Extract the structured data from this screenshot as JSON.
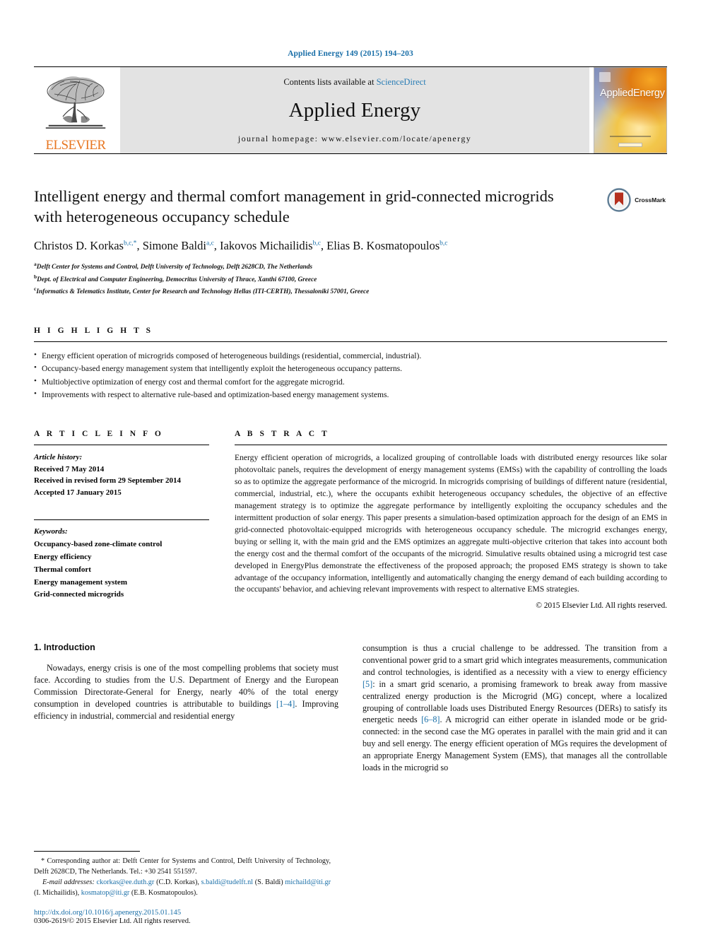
{
  "running_head": "Applied Energy 149 (2015) 194–203",
  "masthead": {
    "publisher": "ELSEVIER",
    "contents_prefix": "Contents lists available at ",
    "contents_link": "ScienceDirect",
    "journal_name": "Applied Energy",
    "homepage": "journal homepage: www.elsevier.com/locate/apenergy",
    "cover_title_a": "Applied",
    "cover_title_b": "Energy"
  },
  "article": {
    "title": "Intelligent energy and thermal comfort management in grid-connected microgrids with heterogeneous occupancy schedule",
    "crossmark_label": "CrossMark",
    "authors": [
      {
        "name": "Christos D. Korkas",
        "sup": "b,c,*"
      },
      {
        "name": "Simone Baldi",
        "sup": "a,c"
      },
      {
        "name": "Iakovos Michailidis",
        "sup": "b,c"
      },
      {
        "name": "Elias B. Kosmatopoulos",
        "sup": "b,c"
      }
    ],
    "affiliations": [
      {
        "mark": "a",
        "text": "Delft Center for Systems and Control, Delft University of Technology, Delft 2628CD, The Netherlands"
      },
      {
        "mark": "b",
        "text": "Dept. of Electrical and Computer Engineering, Democritus University of Thrace, Xanthi 67100, Greece"
      },
      {
        "mark": "c",
        "text": "Informatics & Telematics Institute, Center for Research and Technology Hellas (ITI-CERTH), Thessaloniki 57001, Greece"
      }
    ]
  },
  "highlights": {
    "heading": "H I G H L I G H T S",
    "items": [
      "Energy efficient operation of microgrids composed of heterogeneous buildings (residential, commercial, industrial).",
      "Occupancy-based energy management system that intelligently exploit the heterogeneous occupancy patterns.",
      "Multiobjective optimization of energy cost and thermal comfort for the aggregate microgrid.",
      "Improvements with respect to alternative rule-based and optimization-based energy management systems."
    ]
  },
  "article_info": {
    "heading": "A R T I C L E   I N F O",
    "history_label": "Article history:",
    "history": [
      "Received 7 May 2014",
      "Received in revised form 29 September 2014",
      "Accepted 17 January 2015"
    ],
    "keywords_label": "Keywords:",
    "keywords": [
      "Occupancy-based zone-climate control",
      "Energy efficiency",
      "Thermal comfort",
      "Energy management system",
      "Grid-connected microgrids"
    ]
  },
  "abstract": {
    "heading": "A B S T R A C T",
    "text": "Energy efficient operation of microgrids, a localized grouping of controllable loads with distributed energy resources like solar photovoltaic panels, requires the development of energy management systems (EMSs) with the capability of controlling the loads so as to optimize the aggregate performance of the microgrid. In microgrids comprising of buildings of different nature (residential, commercial, industrial, etc.), where the occupants exhibit heterogeneous occupancy schedules, the objective of an effective management strategy is to optimize the aggregate performance by intelligently exploiting the occupancy schedules and the intermittent production of solar energy. This paper presents a simulation-based optimization approach for the design of an EMS in grid-connected photovoltaic-equipped microgrids with heterogeneous occupancy schedule. The microgrid exchanges energy, buying or selling it, with the main grid and the EMS optimizes an aggregate multi-objective criterion that takes into account both the energy cost and the thermal comfort of the occupants of the microgrid. Simulative results obtained using a microgrid test case developed in EnergyPlus demonstrate the effectiveness of the proposed approach; the proposed EMS strategy is shown to take advantage of the occupancy information, intelligently and automatically changing the energy demand of each building according to the occupants' behavior, and achieving relevant improvements with respect to alternative EMS strategies.",
    "copyright": "© 2015 Elsevier Ltd. All rights reserved."
  },
  "introduction": {
    "heading": "1. Introduction",
    "left_paragraph_1": "Nowadays, energy crisis is one of the most compelling problems that society must face. According to studies from the U.S. Department of Energy and the European Commission Directorate-General for Energy, nearly 40% of the total energy consumption in developed countries is attributable to buildings ",
    "left_ref_1": "[1–4]",
    "left_paragraph_1b": ". Improving efficiency in industrial, commercial and residential energy",
    "right_part_1": "consumption is thus a crucial challenge to be addressed. The transition from a conventional power grid to a smart grid which integrates measurements, communication and control technologies, is identified as a necessity with a view to energy efficiency ",
    "right_ref_1": "[5]",
    "right_part_2": ": in a smart grid scenario, a promising framework to break away from massive centralized energy production is the Microgrid (MG) concept, where a localized grouping of controllable loads uses Distributed Energy Resources (DERs) to satisfy its energetic needs ",
    "right_ref_2": "[6–8]",
    "right_part_3": ". A microgrid can either operate in islanded mode or be grid-connected: in the second case the MG operates in parallel with the main grid and it can buy and sell energy. The energy efficient operation of MGs requires the development of an appropriate Energy Management System (EMS), that manages all the controllable loads in the microgrid so"
  },
  "footnotes": {
    "corresponding_marker": "*",
    "corresponding": " Corresponding author at: Delft Center for Systems and Control, Delft University of Technology, Delft 2628CD, The Netherlands. Tel.: +30 2541 551597.",
    "email_label": "E-mail addresses:",
    "emails": [
      {
        "address": "ckorkas@ee.duth.gr",
        "owner": " (C.D. Korkas), "
      },
      {
        "address": "s.baldi@tudelft.nl",
        "owner": " (S. Baldi) "
      },
      {
        "address": "michaild@iti.gr",
        "owner": " (I. Michailidis), "
      },
      {
        "address": "kosmatop@iti.gr",
        "owner": " (E.B. Kosmatopoulos)."
      }
    ],
    "doi": "http://dx.doi.org/10.1016/j.apenergy.2015.01.145",
    "issn": "0306-2619/© 2015 Elsevier Ltd. All rights reserved."
  },
  "colors": {
    "link": "#1a6fa8",
    "elsevier_orange": "#E87722",
    "masthead_bg": "#e3e3e3"
  }
}
